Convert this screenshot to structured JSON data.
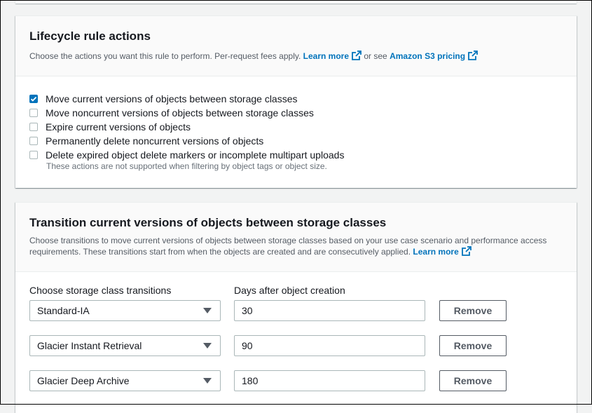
{
  "actions_panel": {
    "title": "Lifecycle rule actions",
    "desc_text": "Choose the actions you want this rule to perform. Per-request fees apply.",
    "learn_more": "Learn more",
    "or_see": "or see",
    "pricing_link": "Amazon S3 pricing",
    "options": [
      {
        "label": "Move current versions of objects between storage classes",
        "checked": true
      },
      {
        "label": "Move noncurrent versions of objects between storage classes",
        "checked": false
      },
      {
        "label": "Expire current versions of objects",
        "checked": false
      },
      {
        "label": "Permanently delete noncurrent versions of objects",
        "checked": false
      },
      {
        "label": "Delete expired object delete markers or incomplete multipart uploads",
        "checked": false
      }
    ],
    "hint": "These actions are not supported when filtering by object tags or object size."
  },
  "transitions_panel": {
    "title": "Transition current versions of objects between storage classes",
    "desc_text": "Choose transitions to move current versions of objects between storage classes based on your use case scenario and performance access requirements. These transitions start from when the objects are created and are consecutively applied.",
    "learn_more": "Learn more",
    "col_storage_label": "Choose storage class transitions",
    "col_days_label": "Days after object creation",
    "rows": [
      {
        "storage_class": "Standard-IA",
        "days": "30",
        "remove_label": "Remove"
      },
      {
        "storage_class": "Glacier Instant Retrieval",
        "days": "90",
        "remove_label": "Remove"
      },
      {
        "storage_class": "Glacier Deep Archive",
        "days": "180",
        "remove_label": "Remove"
      }
    ]
  },
  "colors": {
    "link": "#0073bb",
    "checkbox_checked": "#0073bb",
    "page_background": "#f2f3f3"
  }
}
